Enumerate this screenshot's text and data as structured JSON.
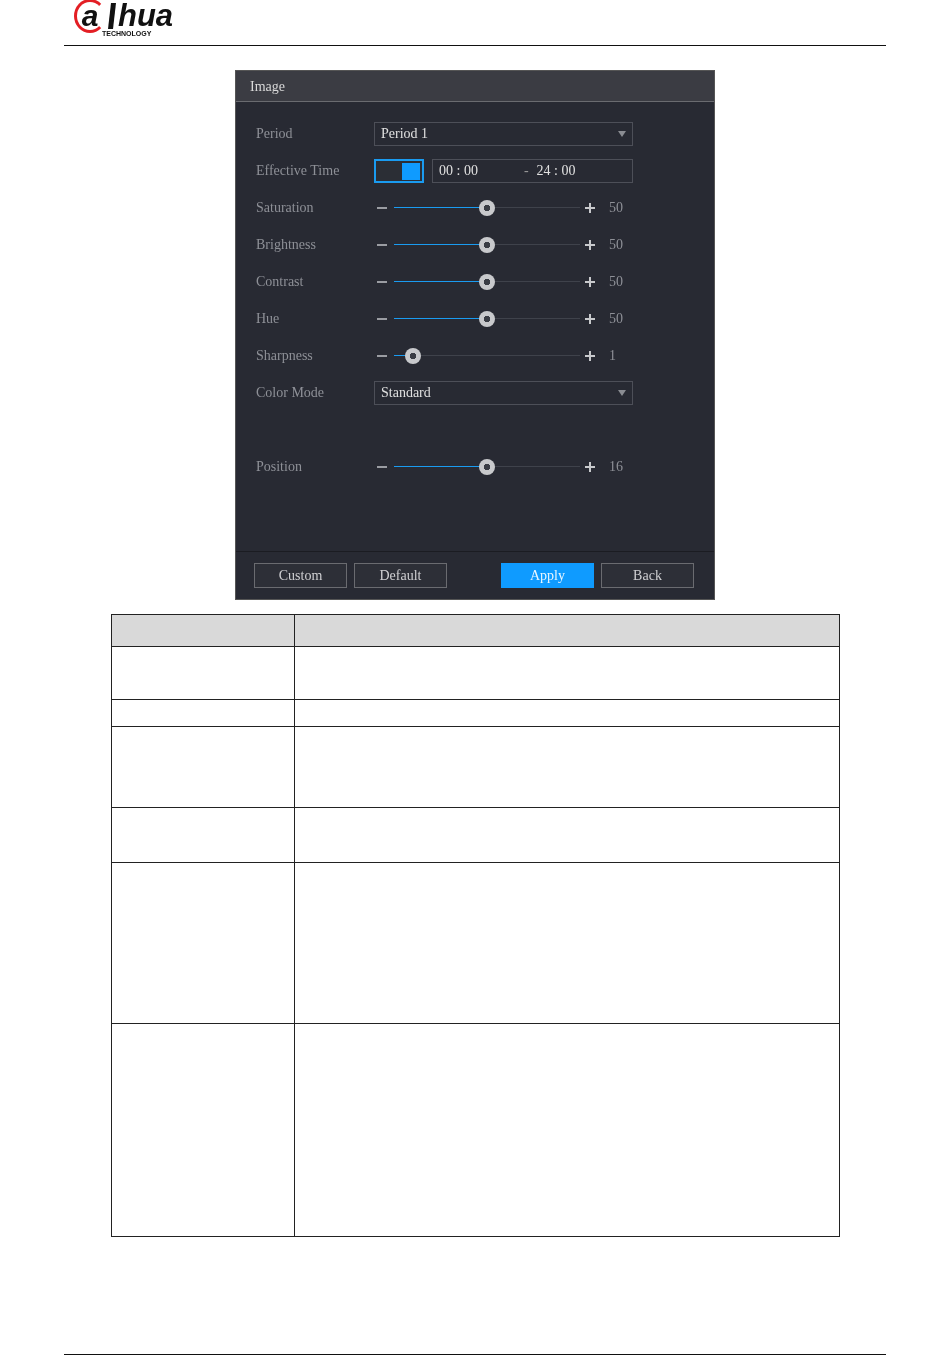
{
  "header": {
    "logo": {
      "mark": "a",
      "name": "hua",
      "tagline": "TECHNOLOGY"
    }
  },
  "window": {
    "title": "Image",
    "rows": [
      {
        "kind": "dropdown",
        "label": "Period",
        "value": "Period 1"
      },
      {
        "kind": "time",
        "label": "Effective Time",
        "on": true,
        "start": "00 : 00",
        "separator": "-",
        "end": "24 : 00"
      },
      {
        "kind": "slider",
        "label": "Saturation",
        "level": 0.5,
        "reading": "50"
      },
      {
        "kind": "slider",
        "label": "Brightness",
        "level": 0.5,
        "reading": "50"
      },
      {
        "kind": "slider",
        "label": "Contrast",
        "level": 0.5,
        "reading": "50"
      },
      {
        "kind": "slider",
        "label": "Hue",
        "level": 0.5,
        "reading": "50"
      },
      {
        "kind": "slider",
        "label": "Sharpness",
        "level": 0.1,
        "reading": "1"
      },
      {
        "kind": "dropdown",
        "label": "Color Mode",
        "value": "Standard"
      },
      {
        "kind": "gap"
      },
      {
        "kind": "slider",
        "label": "Position",
        "level": 0.5,
        "reading": "16"
      }
    ],
    "buttons": [
      {
        "label": "Custom",
        "primary": false
      },
      {
        "label": "Default",
        "primary": false
      },
      {
        "label": "Apply",
        "primary": true
      },
      {
        "label": "Back",
        "primary": false
      }
    ]
  }
}
